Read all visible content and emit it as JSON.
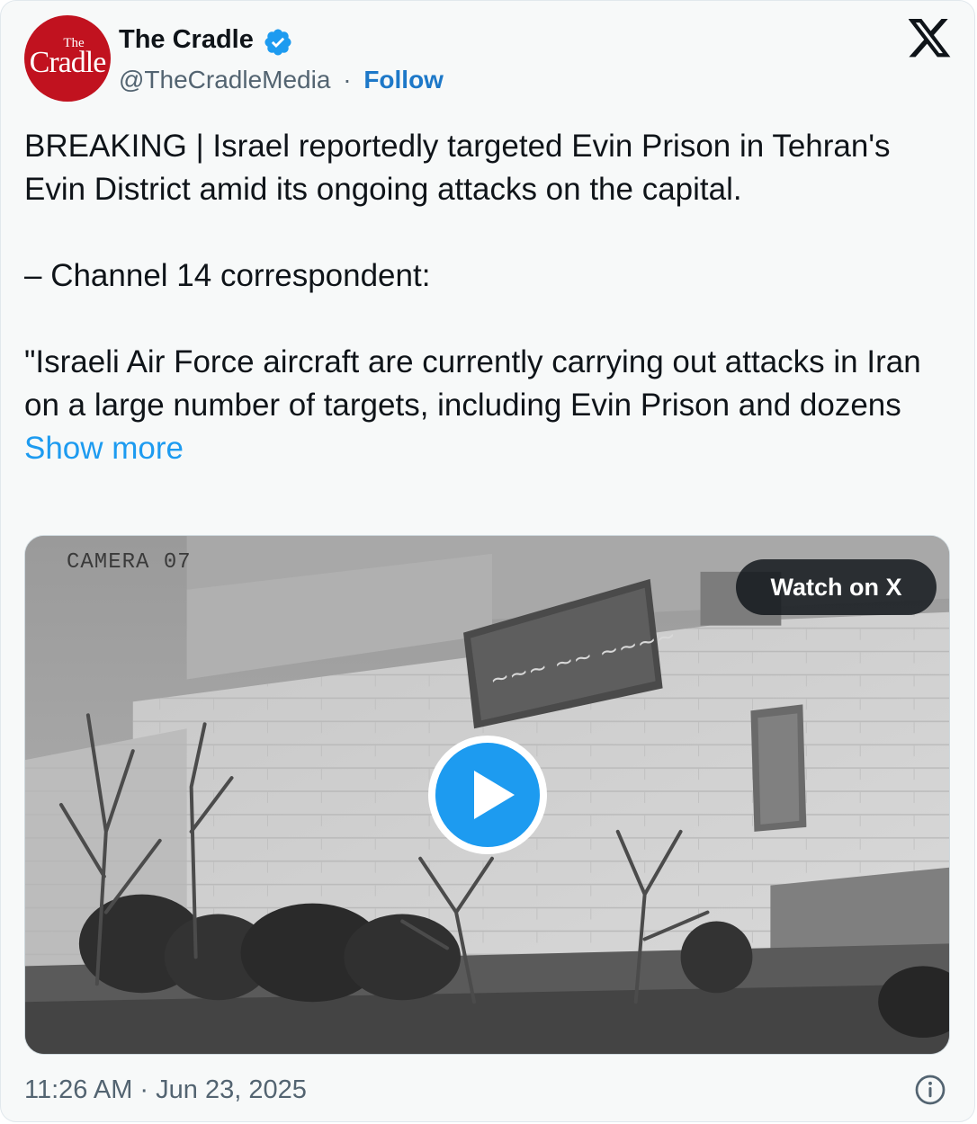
{
  "author": {
    "name": "The Cradle",
    "handle": "@TheCradleMedia",
    "separator": "·",
    "follow_label": "Follow",
    "verified": true,
    "avatar_logo_small": "The",
    "avatar_logo_big": "Cradle",
    "avatar_color": "#c1121f"
  },
  "platform_icon": "x-logo-icon",
  "tweet": {
    "paragraph_1": "BREAKING | Israel reportedly targeted Evin Prison in Tehran's Evin District amid its ongoing attacks on the capital.",
    "paragraph_2": "– Channel 14 correspondent:",
    "paragraph_3": "\"Israeli Air Force aircraft are currently carrying out attacks in Iran on a large number of targets, including Evin Prison and dozens",
    "show_more_label": "Show more"
  },
  "media": {
    "camera_label": "CAMERA 07",
    "watch_label": "Watch on X",
    "play_icon": "play-icon",
    "accent": "#1d9bf0"
  },
  "footer": {
    "timestamp": "11:26 AM · Jun 23, 2025",
    "info_icon": "info-icon"
  }
}
